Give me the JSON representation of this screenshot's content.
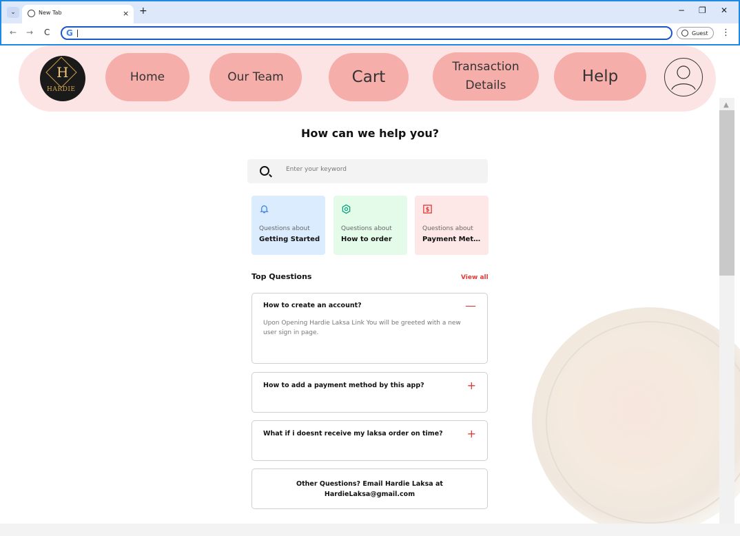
{
  "browser": {
    "tab_title": "New Tab",
    "tab_close": "×",
    "new_tab": "+",
    "tab_menu": "⌄",
    "back": "←",
    "forward": "→",
    "reload": "C",
    "address_value": "",
    "guest_label": "Guest",
    "menu": "⋮",
    "minimize": "−",
    "restore": "❐",
    "close": "✕"
  },
  "navbar": {
    "logo_letter": "H",
    "logo_word": "HARDIE",
    "items": [
      {
        "label": "Home"
      },
      {
        "label": "Our Team"
      },
      {
        "label": "Cart"
      },
      {
        "label": "Transaction Details"
      },
      {
        "label": "Help"
      }
    ]
  },
  "help": {
    "title": "How can we help you?",
    "search_placeholder": "Enter your keyword"
  },
  "categories": [
    {
      "prefix": "Questions about",
      "title": "Getting Started",
      "icon": "bell-icon",
      "bg": "#dcecff",
      "accent": "#3b82f6"
    },
    {
      "prefix": "Questions about",
      "title": "How to order",
      "icon": "hexagon-icon",
      "bg": "#e3fbe8",
      "accent": "#10a37f"
    },
    {
      "prefix": "Questions about",
      "title": "Payment Meth...",
      "icon": "dollar-icon",
      "bg": "#fde7e7",
      "accent": "#e53935"
    }
  ],
  "top_questions": {
    "heading": "Top Questions",
    "view_all": "View all",
    "items": [
      {
        "question": "How to create an account?",
        "answer": "Upon Opening Hardie Laksa Link You will be greeted with a new user sign in page.",
        "toggle": "—"
      },
      {
        "question": "How to add a payment method by this app?",
        "toggle": "+"
      },
      {
        "question": "What if i doesnt receive my laksa order on time?",
        "toggle": "+"
      }
    ],
    "other": "Other Questions? Email Hardie Laksa at HardieLaksa@gmail.com"
  },
  "colors": {
    "navbar_bg": "#fde4e4",
    "pill_bg": "#f6aeaa",
    "accent_red": "#e53935",
    "browser_accent": "#1e88e5"
  }
}
